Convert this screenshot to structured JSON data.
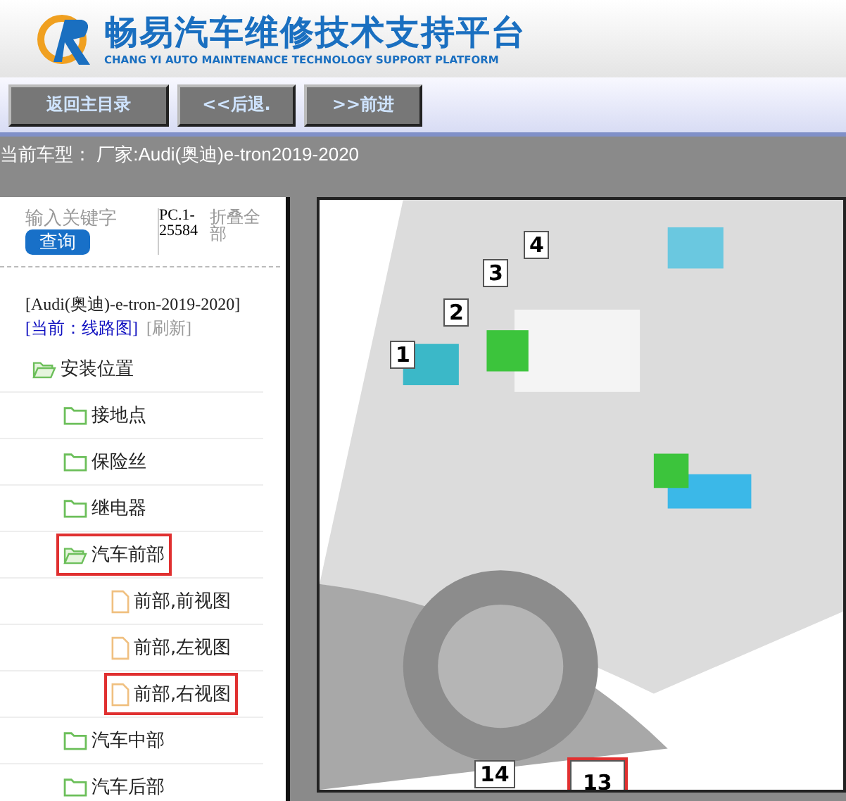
{
  "header": {
    "title": "畅易汽车维修技术支持平台",
    "subtitle": "CHANG YI AUTO MAINTENANCE TECHNOLOGY SUPPORT PLATFORM"
  },
  "toolbar": {
    "buttons": [
      "返回主目录",
      "<<后退.",
      ">>前进"
    ]
  },
  "vehicle_bar": {
    "text": "当前车型： 厂家:Audi(奥迪)e-tron2019-2020"
  },
  "sidebar": {
    "search": {
      "placeholder": "输入关键字",
      "button": "查询"
    },
    "code": "PC.1-25584",
    "collapse_all": "折叠全部",
    "model": "[Audi(奥迪)-e-tron-2019-2020]",
    "current": "[当前：线路图]",
    "refresh": "[刷新]",
    "tree": [
      {
        "label": "安装位置",
        "kind": "folder",
        "expanded": true,
        "highlighted": false,
        "children": [
          {
            "label": "接地点",
            "kind": "folder",
            "expanded": false,
            "highlighted": false
          },
          {
            "label": "保险丝",
            "kind": "folder",
            "expanded": false,
            "highlighted": false
          },
          {
            "label": "继电器",
            "kind": "folder",
            "expanded": false,
            "highlighted": false
          },
          {
            "label": "汽车前部",
            "kind": "folder",
            "expanded": true,
            "highlighted": true,
            "children": [
              {
                "label": "前部,前视图",
                "kind": "document",
                "highlighted": false
              },
              {
                "label": "前部,左视图",
                "kind": "document",
                "highlighted": false
              },
              {
                "label": "前部,右视图",
                "kind": "document",
                "highlighted": true
              }
            ]
          },
          {
            "label": "汽车中部",
            "kind": "folder",
            "expanded": false,
            "highlighted": false
          },
          {
            "label": "汽车后部",
            "kind": "folder",
            "expanded": false,
            "highlighted": false
          }
        ]
      }
    ]
  },
  "diagram": {
    "callouts": [
      {
        "label": "4",
        "highlighted": false
      },
      {
        "label": "3",
        "highlighted": false
      },
      {
        "label": "2",
        "highlighted": false
      },
      {
        "label": "1",
        "highlighted": false
      },
      {
        "label": "14",
        "highlighted": false
      },
      {
        "label": "13",
        "highlighted": true
      }
    ]
  }
}
